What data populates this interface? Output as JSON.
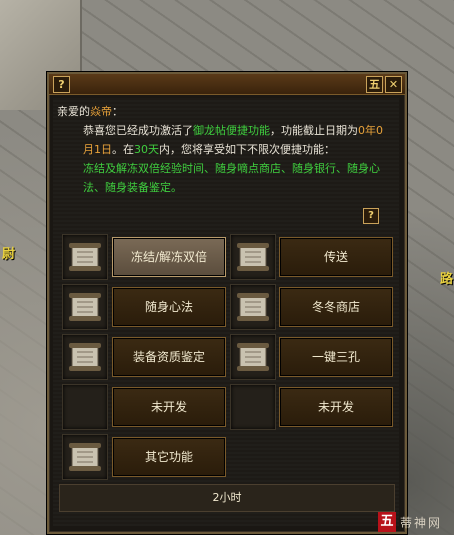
{
  "scene": {
    "side_left_text": "尉",
    "side_right_text": "路"
  },
  "dialog": {
    "help_label": "?",
    "five_label": "五",
    "close_label": "✕",
    "greeting_prefix": "亲爱的",
    "player_name": "焱帝",
    "greeting_suffix": "：",
    "line1_a": "恭喜您已经成功激活了",
    "line1_feature": "御龙帖便捷功能",
    "line1_b": "，功能截止日期为",
    "line1_date": "0年0月1日",
    "line1_c": "。在",
    "line1_days": "30天",
    "line1_d": "内，您将享受如下不限次便捷功能：",
    "features_text": "冻结及解冻双倍经验时间、随身嘀点商店、随身银行、随身心法、随身装备鉴定。",
    "help_mid_label": "?",
    "buttons": [
      {
        "label": "冻结/解冻双倍",
        "active": true
      },
      {
        "label": "传送"
      },
      {
        "label": "随身心法"
      },
      {
        "label": "冬冬商店"
      },
      {
        "label": "装备资质鉴定"
      },
      {
        "label": "一键三孔"
      },
      {
        "label": "未开发"
      },
      {
        "label": "未开发"
      },
      {
        "label": "其它功能"
      }
    ],
    "status_text": "2小时"
  },
  "watermark": {
    "box": "五",
    "text": "蒂神网"
  }
}
